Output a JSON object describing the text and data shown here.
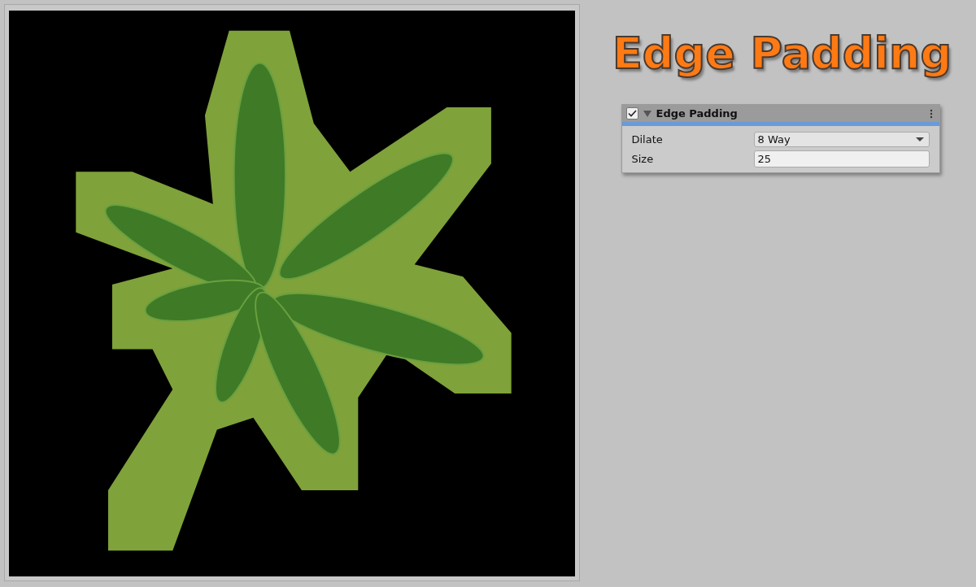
{
  "heading": "Edge Padding",
  "component": {
    "enabled": true,
    "expanded": true,
    "title": "Edge Padding",
    "fields": [
      {
        "kind": "dropdown",
        "label": "Dilate",
        "value": "8 Way"
      },
      {
        "kind": "number",
        "label": "Size",
        "value": "25"
      }
    ]
  }
}
